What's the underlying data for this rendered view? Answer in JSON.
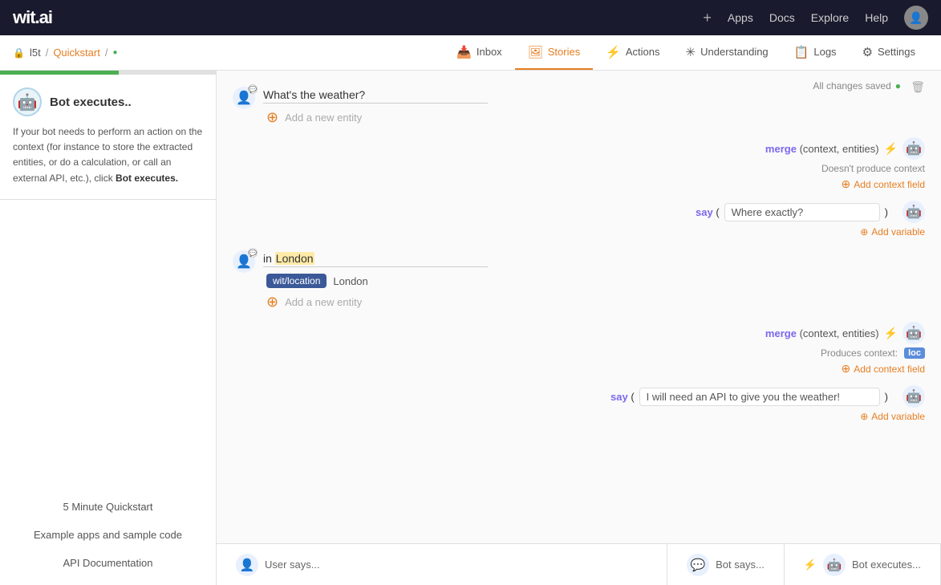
{
  "topNav": {
    "logo": "wit.ai",
    "addLabel": "+",
    "appsLabel": "Apps",
    "docsLabel": "Docs",
    "exploreLabel": "Explore",
    "helpLabel": "Help"
  },
  "breadcrumb": {
    "appName": "l5t",
    "sep1": "/",
    "storyName": "Quickstart",
    "sep2": "/"
  },
  "tabs": [
    {
      "id": "inbox",
      "icon": "📥",
      "label": "Inbox"
    },
    {
      "id": "stories",
      "icon": "🖼",
      "label": "Stories"
    },
    {
      "id": "actions",
      "icon": "⚡",
      "label": "Actions"
    },
    {
      "id": "understanding",
      "icon": "✳",
      "label": "Understanding"
    },
    {
      "id": "logs",
      "icon": "📋",
      "label": "Logs"
    },
    {
      "id": "settings",
      "icon": "⚙",
      "label": "Settings"
    }
  ],
  "saveStatus": "All changes saved",
  "sidebar": {
    "botExecutesTitle": "Bot executes..",
    "botExecutesDesc": "If your bot needs to perform an action on the context (for instance to store the extracted entities, or do a calculation, or call an external API, etc.), click ",
    "botExecutesBold": "Bot executes.",
    "links": [
      "5 Minute Quickstart",
      "Example apps and sample code",
      "API Documentation"
    ]
  },
  "story": {
    "turn1": {
      "userText": "What's the weather?",
      "addEntityLabel": "Add a new entity"
    },
    "botAction1": {
      "funcName": "merge",
      "params": "(context, entities)",
      "noContext": "Doesn't produce context",
      "addContextLabel": "Add context field"
    },
    "botSay1": {
      "funcName": "say",
      "sayText": "Where exactly?",
      "addVariableLabel": "Add variable"
    },
    "turn2": {
      "userText": "in London",
      "highlightedWord": "London",
      "entityTag": "wit/location",
      "entityValue": "London",
      "addEntityLabel": "Add a new entity"
    },
    "botAction2": {
      "funcName": "merge",
      "params": "(context, entities)",
      "producesContext": "Produces context:",
      "contextBadge": "loc",
      "addContextLabel": "Add context field"
    },
    "botSay2": {
      "funcName": "say",
      "sayText": "I will need an API to give you the weather!",
      "addVariableLabel": "Add variable"
    }
  },
  "bottomBar": {
    "userSaysLabel": "User says...",
    "botSaysLabel": "Bot says...",
    "botExecutesLabel": "Bot executes..."
  }
}
